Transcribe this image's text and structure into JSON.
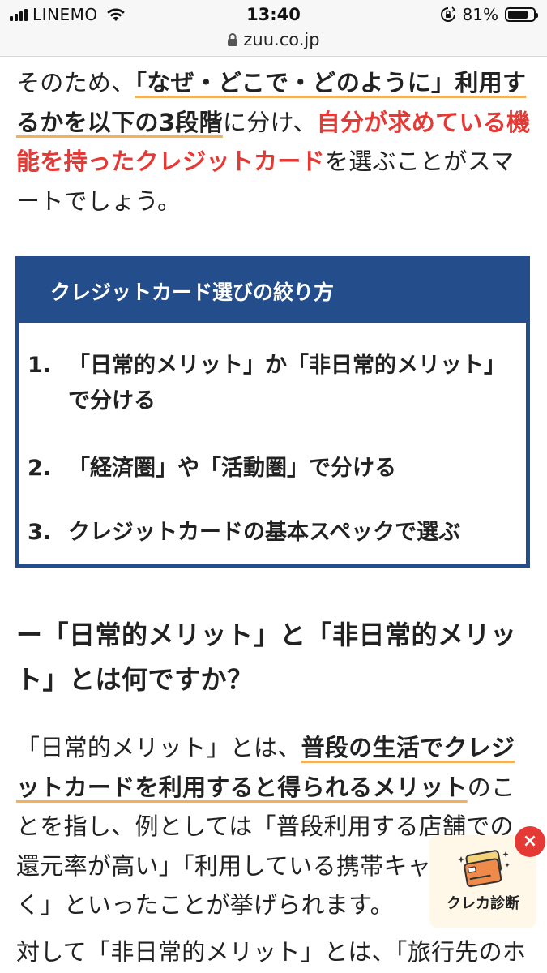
{
  "status_bar": {
    "carrier": "LINEMO",
    "time": "13:40",
    "battery_percent": "81%",
    "battery_level": 0.81
  },
  "browser": {
    "url": "zuu.co.jp"
  },
  "article": {
    "p1": {
      "t1": "そのため、",
      "h1": "「なぜ・どこで・どのように」利用するかを以下の3段階",
      "t2": "に分け、",
      "r1": "自分が求めている機能を持ったクレジットカード",
      "t3": "を選ぶことがスマートでしょう。"
    },
    "box": {
      "title": "クレジットカード選びの絞り方",
      "items": [
        {
          "num": "1.",
          "text": "「日常的メリット」か「非日常的メリット」で分ける"
        },
        {
          "num": "2.",
          "text": "「経済圏」や「活動圏」で分ける"
        },
        {
          "num": "3.",
          "text": "クレジットカードの基本スペックで選ぶ"
        }
      ]
    },
    "heading": "ー「日常的メリット」と「非日常的メリット」とは何ですか？",
    "p2": {
      "t1": "「日常的メリット」とは、",
      "h1": "普段の生活でクレジットカードを利用すると得られるメリット",
      "t2": "のことを指し、例としては「普段利用する店舗での還元率が高い」「利用している携帯キャリアに",
      "t3": "く」といったことが挙げられます。"
    },
    "p3": {
      "text": "対して「非日常的メリット」とは、「旅行先のホ"
    }
  },
  "widget": {
    "label": "クレカ診断",
    "close": "×",
    "icon": "credit-card-icon"
  },
  "colors": {
    "accent_blue": "#234d8b",
    "accent_red": "#e53935",
    "underline_orange": "#f2b15e"
  }
}
